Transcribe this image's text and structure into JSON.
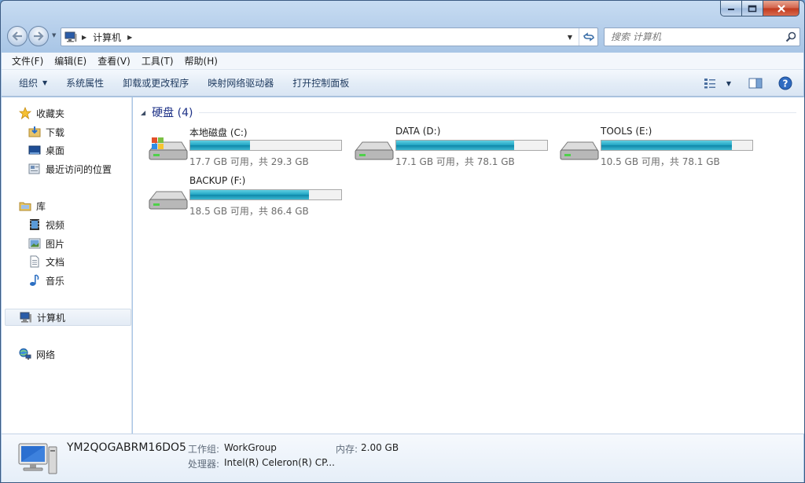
{
  "window": {
    "colors": {
      "accent": "#1e3287",
      "drive_bar": "#1fa3c2",
      "close": "#c0391d"
    }
  },
  "address_bar": {
    "breadcrumb": [
      "计算机"
    ],
    "search_placeholder": "搜索 计算机"
  },
  "menu": {
    "items": [
      "文件(F)",
      "编辑(E)",
      "查看(V)",
      "工具(T)",
      "帮助(H)"
    ]
  },
  "toolbar": {
    "organize": "组织",
    "system_properties": "系统属性",
    "uninstall": "卸载或更改程序",
    "map_drive": "映射网络驱动器",
    "control_panel": "打开控制面板"
  },
  "sidebar": {
    "favorites": {
      "label": "收藏夹",
      "items": [
        "下载",
        "桌面",
        "最近访问的位置"
      ]
    },
    "libraries": {
      "label": "库",
      "items": [
        "视频",
        "图片",
        "文档",
        "音乐"
      ]
    },
    "computer": "计算机",
    "network": "网络"
  },
  "content": {
    "group_title": "硬盘 (4)",
    "drives": [
      {
        "name": "本地磁盘 (C:)",
        "info": "17.7 GB 可用，共 29.3 GB",
        "used_fraction": 0.396
      },
      {
        "name": "DATA (D:)",
        "info": "17.1 GB 可用，共 78.1 GB",
        "used_fraction": 0.781
      },
      {
        "name": "TOOLS (E:)",
        "info": "10.5 GB 可用，共 78.1 GB",
        "used_fraction": 0.866
      },
      {
        "name": "BACKUP (F:)",
        "info": "18.5 GB 可用，共 86.4 GB",
        "used_fraction": 0.786
      }
    ]
  },
  "details": {
    "computer_name": "YM2QOGABRM16DO5",
    "workgroup_label": "工作组:",
    "workgroup_value": "WorkGroup",
    "memory_label": "内存:",
    "memory_value": "2.00 GB",
    "processor_label": "处理器:",
    "processor_value": "Intel(R) Celeron(R) CP..."
  }
}
